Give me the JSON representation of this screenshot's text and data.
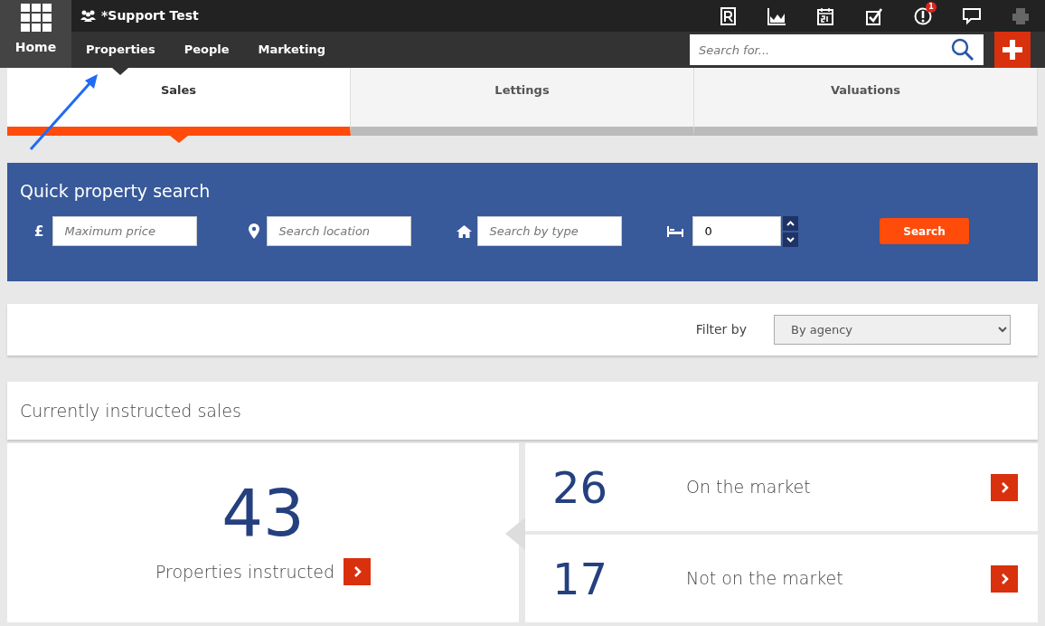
{
  "header": {
    "home_label": "Home",
    "account": "*Support Test",
    "toolbar": [
      {
        "kind": "register"
      },
      {
        "kind": "chart"
      },
      {
        "kind": "calendar"
      },
      {
        "kind": "tasks"
      },
      {
        "kind": "alerts",
        "badge": "1"
      },
      {
        "kind": "messages"
      },
      {
        "kind": "print",
        "disabled": true
      }
    ],
    "nav": [
      {
        "label": "Properties",
        "selected": true
      },
      {
        "label": "People",
        "selected": false
      },
      {
        "label": "Marketing",
        "selected": false
      }
    ],
    "search": {
      "placeholder": "Search for..."
    }
  },
  "tabs": [
    {
      "label": "Sales",
      "selected": true
    },
    {
      "label": "Lettings",
      "selected": false
    },
    {
      "label": "Valuations",
      "selected": false
    }
  ],
  "quick_search": {
    "title": "Quick property search",
    "price_symbol": "£",
    "price_placeholder": "Maximum price",
    "location_placeholder": "Search location",
    "type_placeholder": "Search by type",
    "bedrooms": "0",
    "button": "Search"
  },
  "filter": {
    "label": "Filter by",
    "value": "By agency"
  },
  "summary": {
    "title": "Currently instructed sales",
    "total": "43",
    "total_label": "Properties instructed",
    "breakdown": [
      {
        "count": "26",
        "label": "On the market"
      },
      {
        "count": "17",
        "label": "Not on the market"
      }
    ]
  }
}
